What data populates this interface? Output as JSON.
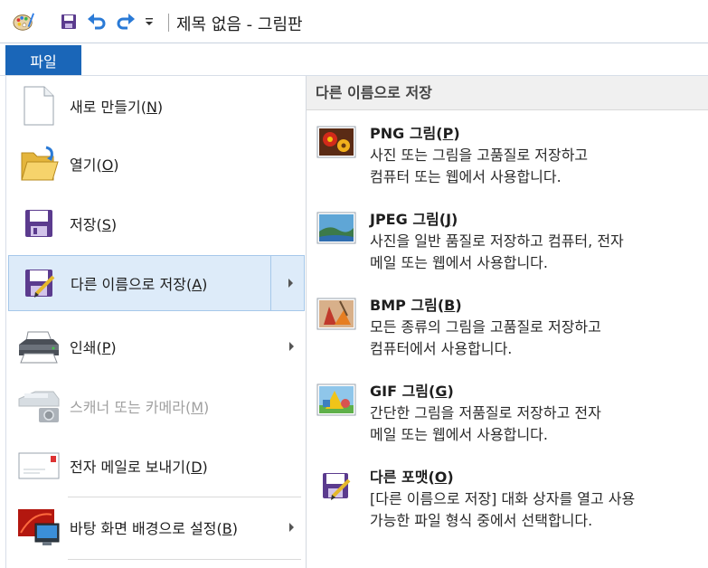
{
  "titlebar": {
    "title": "제목 없음 - 그림판"
  },
  "menubar": {
    "file_tab": "파일"
  },
  "left_menu": {
    "items": [
      {
        "label": "새로 만들기",
        "key": "N",
        "icon": "new-document-icon",
        "arrow": false,
        "state": "normal"
      },
      {
        "label": "열기",
        "key": "O",
        "icon": "open-folder-icon",
        "arrow": false,
        "state": "normal"
      },
      {
        "label": "저장",
        "key": "S",
        "icon": "save-floppy-icon",
        "arrow": false,
        "state": "normal"
      },
      {
        "label": "다른 이름으로 저장",
        "key": "A",
        "icon": "save-as-icon",
        "arrow": true,
        "state": "selected"
      },
      {
        "label": "인쇄",
        "key": "P",
        "icon": "printer-icon",
        "arrow": true,
        "state": "normal"
      },
      {
        "label": "스캐너 또는 카메라",
        "key": "M",
        "icon": "scanner-camera-icon",
        "arrow": false,
        "state": "disabled"
      },
      {
        "label": "전자 메일로 보내기",
        "key": "D",
        "icon": "email-envelope-icon",
        "arrow": false,
        "state": "normal"
      },
      {
        "label": "바탕 화면 배경으로 설정",
        "key": "B",
        "icon": "desktop-background-icon",
        "arrow": true,
        "state": "normal"
      }
    ]
  },
  "right_panel": {
    "header": "다른 이름으로 저장",
    "options": [
      {
        "title": "PNG 그림",
        "key": "P",
        "desc1": "사진 또는 그림을 고품질로 저장하고",
        "desc2": "컴퓨터 또는 웹에서 사용합니다.",
        "icon": "png-image-icon"
      },
      {
        "title": "JPEG 그림",
        "key": "J",
        "desc1": "사진을 일반 품질로 저장하고 컴퓨터, 전자",
        "desc2": "메일 또는 웹에서 사용합니다.",
        "icon": "jpeg-image-icon"
      },
      {
        "title": "BMP 그림",
        "key": "B",
        "desc1": "모든 종류의 그림을 고품질로 저장하고",
        "desc2": "컴퓨터에서 사용합니다.",
        "icon": "bmp-image-icon"
      },
      {
        "title": "GIF 그림",
        "key": "G",
        "desc1": "간단한 그림을 저품질로 저장하고 전자",
        "desc2": "메일 또는 웹에서 사용합니다.",
        "icon": "gif-image-icon"
      },
      {
        "title": "다른 포맷",
        "key": "O",
        "desc1": "[다른 이름으로 저장] 대화 상자를 열고 사용",
        "desc2": "가능한 파일 형식 중에서 선택합니다.",
        "icon": "other-format-icon"
      }
    ]
  },
  "colors": {
    "accent": "#1a66b8",
    "selected_bg": "#ddebf9",
    "selected_border": "#a6c8ea",
    "disabled_text": "#a0a0a0"
  }
}
